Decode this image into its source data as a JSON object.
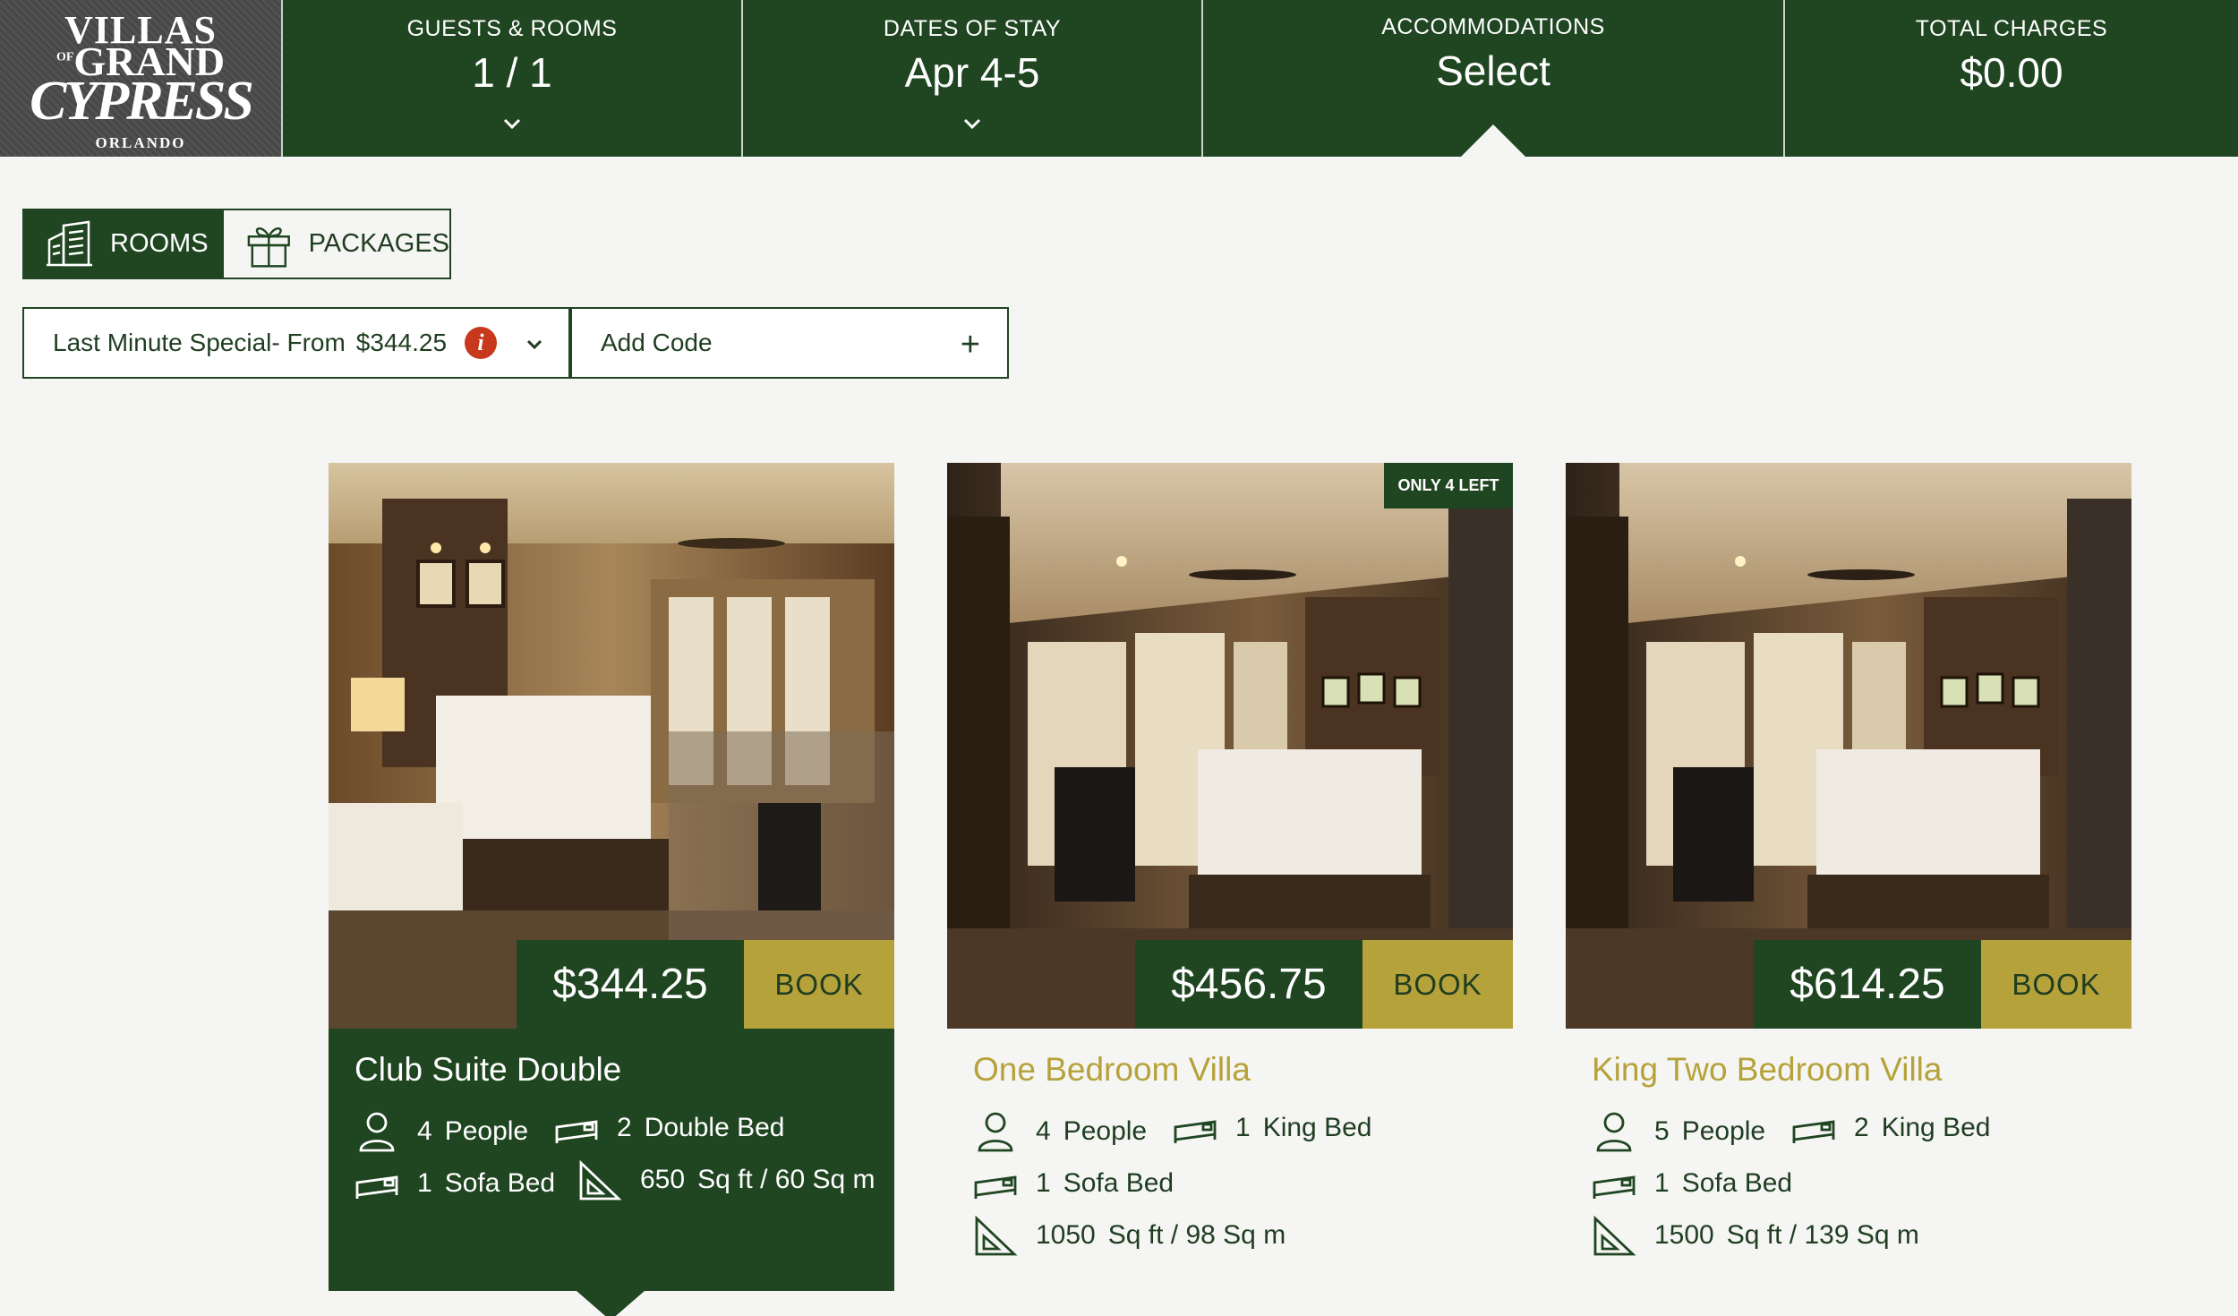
{
  "logo": {
    "line1": "VILLAS",
    "line2_of": "OF",
    "line2": "GRAND",
    "line3": "CYPRESS",
    "line4": "ORLANDO"
  },
  "header": {
    "guests": {
      "label": "GUESTS & ROOMS",
      "value": "1 / 1"
    },
    "dates": {
      "label": "DATES OF STAY",
      "value": "Apr 4-5"
    },
    "accommodations": {
      "label": "ACCOMMODATIONS",
      "value": "Select"
    },
    "total": {
      "label": "TOTAL CHARGES",
      "value": "$0.00"
    }
  },
  "tabs": {
    "rooms": "ROOMS",
    "packages": "PACKAGES"
  },
  "promo": {
    "rate_label": "Last Minute Special- From",
    "rate_price": "$344.25",
    "code_placeholder": "Add Code",
    "plus": "+"
  },
  "rooms": [
    {
      "name": "Club Suite Double",
      "price": "$344.25",
      "book": "BOOK",
      "people_num": "4",
      "people_label": "People",
      "bed_num": "2",
      "bed_label": "Double Bed",
      "sofa_num": "1",
      "sofa_label": "Sofa Bed",
      "area_num": "650",
      "area_label": "Sq ft / 60 Sq m"
    },
    {
      "name": "One Bedroom Villa",
      "price": "$456.75",
      "book": "BOOK",
      "badge": "ONLY 4 LEFT",
      "people_num": "4",
      "people_label": "People",
      "bed_num": "1",
      "bed_label": "King Bed",
      "sofa_num": "1",
      "sofa_label": "Sofa Bed",
      "area_num": "1050",
      "area_label": "Sq ft / 98 Sq m"
    },
    {
      "name": "King Two Bedroom Villa",
      "price": "$614.25",
      "book": "BOOK",
      "people_num": "5",
      "people_label": "People",
      "bed_num": "2",
      "bed_label": "King Bed",
      "sofa_num": "1",
      "sofa_label": "Sofa Bed",
      "area_num": "1500",
      "area_label": "Sq ft / 139 Sq m"
    }
  ],
  "colors": {
    "brand_green": "#1f4521",
    "gold": "#b6a23a",
    "info_red": "#c8381c",
    "background": "#f5f5f3"
  }
}
